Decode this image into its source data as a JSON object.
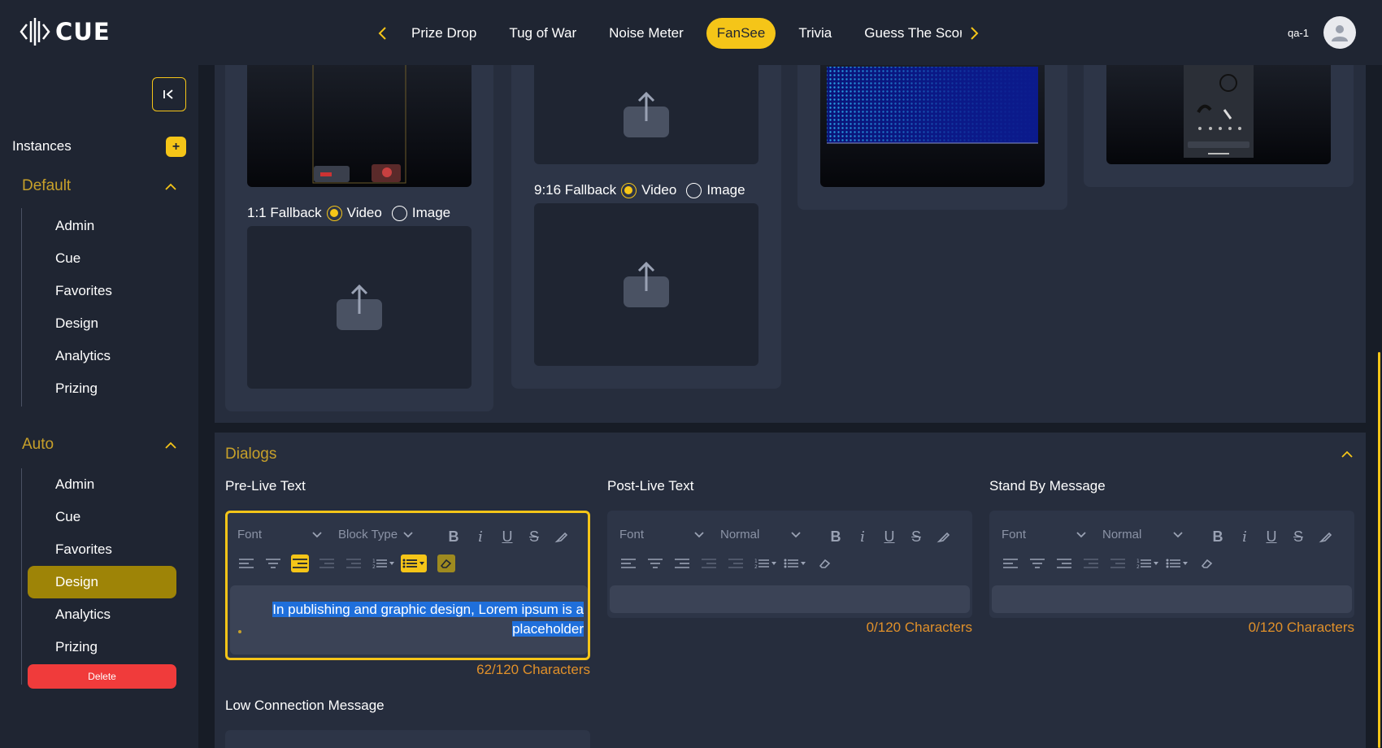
{
  "brand": {
    "name": "CUE"
  },
  "nav": {
    "tabs": [
      {
        "label": "Prize Drop"
      },
      {
        "label": "Tug of War"
      },
      {
        "label": "Noise Meter"
      },
      {
        "label": "FanSee",
        "active": true
      },
      {
        "label": "Trivia"
      },
      {
        "label": "Guess The Score"
      }
    ]
  },
  "user": {
    "name": "qa-1"
  },
  "sidebar": {
    "instances_label": "Instances",
    "add_symbol": "+",
    "groups": [
      {
        "title": "Default",
        "items": [
          "Admin",
          "Cue",
          "Favorites",
          "Design",
          "Analytics",
          "Prizing"
        ]
      },
      {
        "title": "Auto",
        "items": [
          "Admin",
          "Cue",
          "Favorites",
          "Design",
          "Analytics",
          "Prizing"
        ],
        "active_item": "Design"
      }
    ],
    "delete_label": "Delete"
  },
  "media": {
    "fallback_1_1": {
      "label": "1:1 Fallback",
      "option_video": "Video",
      "option_image": "Image",
      "selected": "Video"
    },
    "fallback_9_16": {
      "label": "9:16 Fallback",
      "option_video": "Video",
      "option_image": "Image",
      "selected": "Video"
    }
  },
  "dialogs": {
    "title": "Dialogs",
    "fields": [
      {
        "label": "Pre-Live Text",
        "font_placeholder": "Font",
        "block_type": "Block Type",
        "value": "In publishing and graphic design, Lorem ipsum is a placeholder",
        "value_line1": "In publishing and graphic design, Lorem ipsum is a",
        "value_line2": "placeholder",
        "count": "62/120 Characters"
      },
      {
        "label": "Post-Live Text",
        "font_placeholder": "Font",
        "block_type": "Normal",
        "value": "",
        "count": "0/120 Characters"
      },
      {
        "label": "Stand By Message",
        "font_placeholder": "Font",
        "block_type": "Normal",
        "value": "",
        "count": "0/120 Characters"
      },
      {
        "label": "Low Connection Message"
      }
    ]
  },
  "colors": {
    "accent": "#f5c518",
    "active_item_bg": "#9e8407",
    "delete": "#f03b3b",
    "char_count": "#e0902a",
    "selection": "#1f6fdb"
  }
}
